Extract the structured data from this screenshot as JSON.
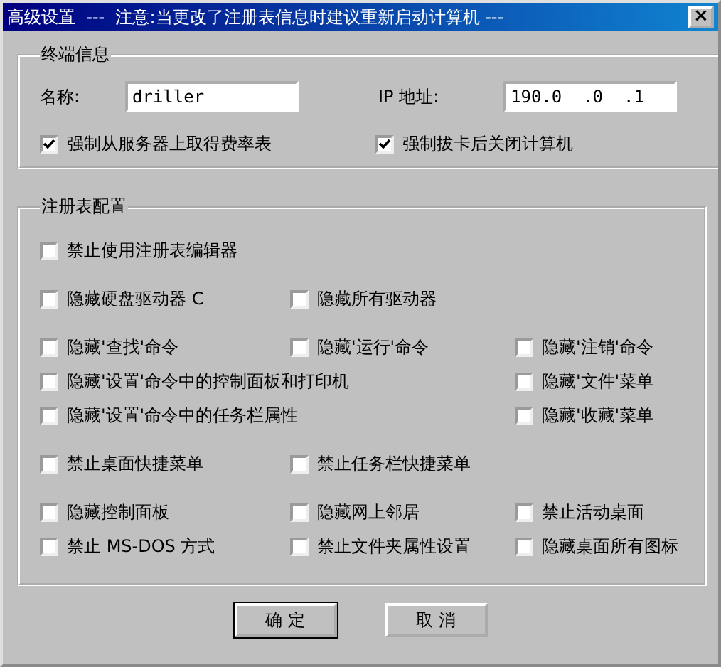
{
  "window": {
    "title": "高级设置  ---  注意:当更改了注册表信息时建议重新启动计算机 ---",
    "close": "×"
  },
  "terminal": {
    "title": "终端信息",
    "name_label": "名称:",
    "name_value": "driller",
    "ip_label": "IP 地址:",
    "ip_value": "190.0  .0  .1",
    "options": [
      {
        "label": "强制从服务器上取得费率表",
        "checked": true
      },
      {
        "label": "强制拔卡后关闭计算机",
        "checked": true
      }
    ]
  },
  "registry": {
    "title": "注册表配置",
    "groups": [
      [
        {
          "column_1": {
            "label": "禁止使用注册表编辑器",
            "checked": false
          }
        }
      ],
      [
        {
          "column_1": {
            "label": "隐藏硬盘驱动器 C",
            "checked": false
          },
          "column_2": {
            "label": "隐藏所有驱动器",
            "checked": false
          }
        }
      ],
      [
        {
          "column_1": {
            "label": "隐藏'查找'命令",
            "checked": false
          },
          "column_2": {
            "label": "隐藏'运行'命令",
            "checked": false
          },
          "column_3": {
            "label": "隐藏'注销'命令",
            "checked": false
          }
        },
        {
          "column_1": {
            "label": "隐藏'设置'命令中的控制面板和打印机",
            "checked": false
          },
          "column_3": {
            "label": "隐藏'文件'菜单",
            "checked": false
          }
        },
        {
          "column_1": {
            "label": "隐藏'设置'命令中的任务栏属性",
            "checked": false
          },
          "column_3": {
            "label": "隐藏'收藏'菜单",
            "checked": false
          }
        }
      ],
      [
        {
          "column_1": {
            "label": "禁止桌面快捷菜单",
            "checked": false
          },
          "column_2": {
            "label": "禁止任务栏快捷菜单",
            "checked": false
          }
        }
      ],
      [
        {
          "column_1": {
            "label": "隐藏控制面板",
            "checked": false
          },
          "column_2": {
            "label": "隐藏网上邻居",
            "checked": false
          },
          "column_3": {
            "label": "禁止活动桌面",
            "checked": false
          }
        },
        {
          "column_1": {
            "label": "禁止 MS-DOS 方式",
            "checked": false
          },
          "column_2": {
            "label": "禁止文件夹属性设置",
            "checked": false
          },
          "column_3": {
            "label": "隐藏桌面所有图标",
            "checked": false
          }
        }
      ]
    ]
  },
  "buttons": [
    {
      "label": "确 定",
      "default": true
    },
    {
      "label": "取 消",
      "default": false
    }
  ]
}
